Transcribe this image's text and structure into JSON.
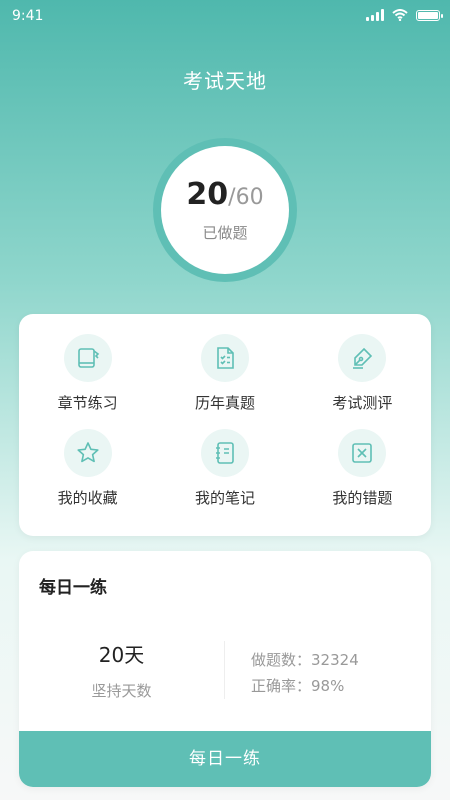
{
  "status_bar": {
    "time": "9:41",
    "battery_level": 1.0
  },
  "header": {
    "title": "考试天地"
  },
  "progress": {
    "done": "20",
    "separator": "/",
    "total": "60",
    "label": "已做题"
  },
  "menu": [
    {
      "label": "章节练习",
      "icon": "book-icon"
    },
    {
      "label": "历年真题",
      "icon": "checklist-icon"
    },
    {
      "label": "考试测评",
      "icon": "pen-icon"
    },
    {
      "label": "我的收藏",
      "icon": "star-icon"
    },
    {
      "label": "我的笔记",
      "icon": "notebook-icon"
    },
    {
      "label": "我的错题",
      "icon": "x-box-icon"
    }
  ],
  "daily": {
    "title": "每日一练",
    "streak_value": "20天",
    "streak_label": "坚持天数",
    "answered_label": "做题数：",
    "answered_value": "32324",
    "accuracy_label": "正确率：",
    "accuracy_value": "98%",
    "button_label": "每日一练"
  },
  "colors": {
    "accent": "#5fbfb5",
    "icon_bg": "#eaf6f4"
  }
}
